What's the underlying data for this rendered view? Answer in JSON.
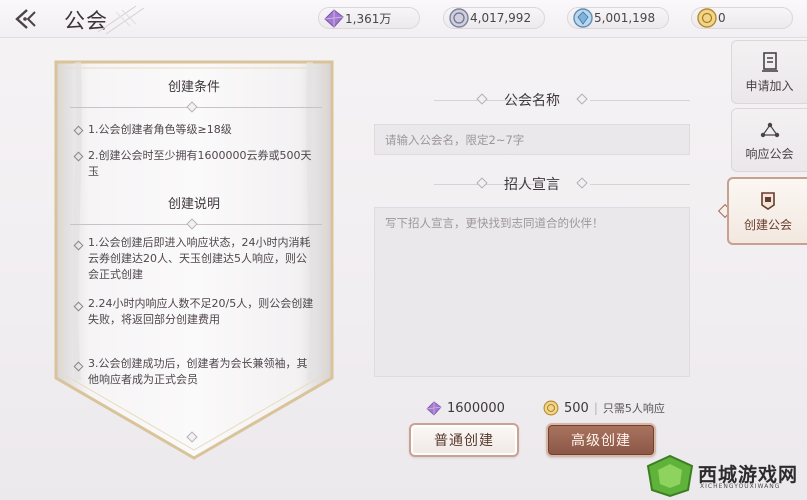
{
  "header": {
    "title": "公会",
    "currencies": [
      {
        "icon": "purple-crystal-icon",
        "value": "1,361万"
      },
      {
        "icon": "silver-coin-icon",
        "value": "4,017,992"
      },
      {
        "icon": "blue-gem-icon",
        "value": "5,001,198"
      },
      {
        "icon": "gold-coin-icon",
        "value": "0"
      }
    ]
  },
  "banner": {
    "conditions_title": "创建条件",
    "conditions": [
      "1.公会创建者角色等级≥18级",
      "2.创建公会时至少拥有1600000云券或500天玉"
    ],
    "rules_title": "创建说明",
    "rules": [
      "1.公会创建后即进入响应状态，24小时内消耗云券创建达20人、天玉创建达5人响应，则公会正式创建",
      "2.24小时内响应人数不足20/5人，则公会创建失败，将返回部分创建费用",
      "3.公会创建成功后，创建者为会长兼领袖，其他响应者成为正式会员"
    ]
  },
  "form": {
    "name_label": "公会名称",
    "name_placeholder": "请输入公会名，限定2~7字",
    "declaration_label": "招人宣言",
    "declaration_placeholder": "写下招人宣言，更快找到志同道合的伙伴！"
  },
  "costs": {
    "normal_amount": "1600000",
    "advanced_amount": "500",
    "advanced_note": "只需5人响应"
  },
  "buttons": {
    "normal": "普通创建",
    "advanced": "高级创建"
  },
  "tabs": [
    {
      "label": "申请加入",
      "icon": "document-icon"
    },
    {
      "label": "响应公会",
      "icon": "network-icon"
    },
    {
      "label": "创建公会",
      "icon": "banner-flag-icon",
      "active": true
    }
  ],
  "watermark": {
    "text": "西城游戏网",
    "sub": "XICHENGYOUXIWANG"
  },
  "colors": {
    "accent": "#8a5646",
    "accent_border": "#c9a292",
    "gold_frame": "#d9c49a"
  }
}
